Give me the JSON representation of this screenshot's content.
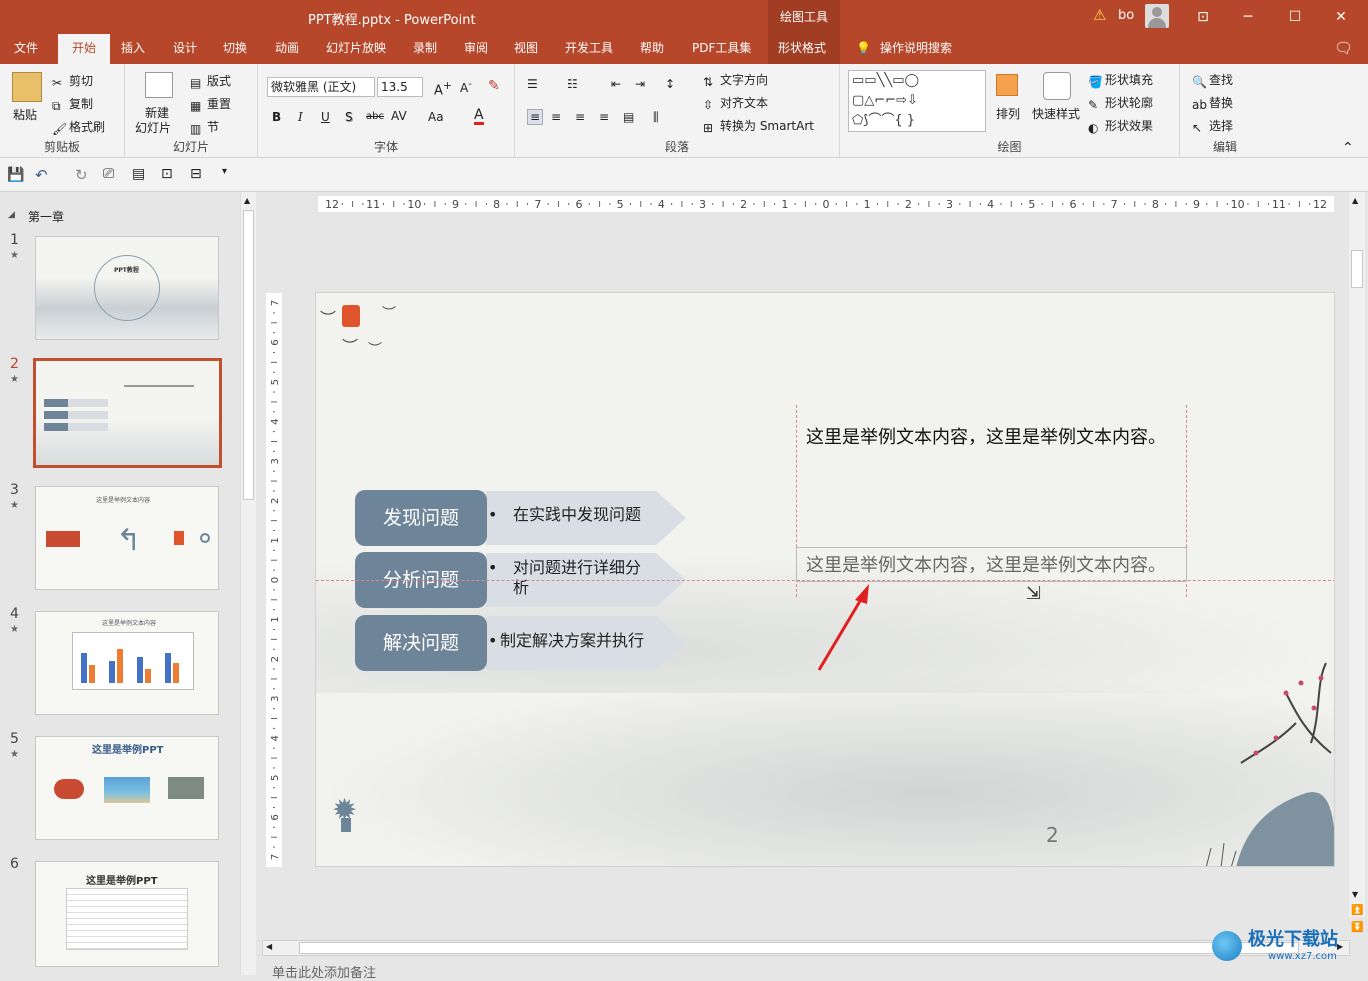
{
  "titlebar": {
    "title": "PPT教程.pptx  -  PowerPoint",
    "context_group": "绘图工具",
    "user": "bo",
    "minimize": "─",
    "restore": "❐",
    "maximize": "☐",
    "close": "✕",
    "display": "⊡"
  },
  "tabs": {
    "file": "文件",
    "home": "开始",
    "insert": "插入",
    "design": "设计",
    "transitions": "切换",
    "animations": "动画",
    "slideshow": "幻灯片放映",
    "record": "录制",
    "review": "审阅",
    "view": "视图",
    "developer": "开发工具",
    "help": "帮助",
    "pdf": "PDF工具集",
    "shape_format": "形状格式",
    "tell_me": "操作说明搜索"
  },
  "ribbon": {
    "clipboard": {
      "paste": "粘贴",
      "cut": "剪切",
      "copy": "复制",
      "format_painter": "格式刷",
      "label": "剪贴板"
    },
    "slides": {
      "new_slide": "新建",
      "new_slide_2": "幻灯片",
      "layout": "版式",
      "reset": "重置",
      "section": "节",
      "label": "幻灯片"
    },
    "font": {
      "font_name": "微软雅黑 (正文)",
      "font_size": "13.5",
      "label": "字体"
    },
    "paragraph": {
      "text_direction": "文字方向",
      "align_text": "对齐文本",
      "smartart": "转换为 SmartArt",
      "label": "段落"
    },
    "drawing": {
      "arrange": "排列",
      "quick_styles": "快速样式",
      "shape_fill": "形状填充",
      "shape_outline": "形状轮廓",
      "shape_effects": "形状效果",
      "label": "绘图"
    },
    "editing": {
      "find": "查找",
      "replace": "替换",
      "select": "选择",
      "label": "编辑"
    }
  },
  "slides_pane": {
    "section": "第一章",
    "slides": [
      {
        "num": "1",
        "title": "PPT教程"
      },
      {
        "num": "2",
        "title": ""
      },
      {
        "num": "3",
        "title": "这里是举例文本内容"
      },
      {
        "num": "4",
        "title": "这里是举例文本内容"
      },
      {
        "num": "5",
        "title": "这里是举例PPT"
      },
      {
        "num": "6",
        "title": "这里是举例PPT"
      }
    ]
  },
  "ruler": {
    "h_ticks": [
      "12",
      "11",
      "10",
      "9",
      "8",
      "7",
      "6",
      "5",
      "4",
      "3",
      "2",
      "1",
      "0",
      "1",
      "2",
      "3",
      "4",
      "5",
      "6",
      "7",
      "8",
      "9",
      "10",
      "11",
      "12"
    ],
    "v_ticks": [
      "7",
      "6",
      "5",
      "4",
      "3",
      "2",
      "1",
      "0",
      "1",
      "2",
      "3",
      "4",
      "5",
      "6",
      "7"
    ]
  },
  "slide": {
    "rows": [
      {
        "label": "发现问题",
        "bullet": "在实践中发现问题"
      },
      {
        "label": "分析问题",
        "bullet": "对问题进行详细分",
        "bullet_line2": "析"
      },
      {
        "label": "解决问题",
        "bullet": "制定解决方案并执行"
      }
    ],
    "bullet_char": "•",
    "textbox1": "这里是举例文本内容，这里是举例文本内容。",
    "textbox2": "这里是举例文本内容，这里是举例文本内容。",
    "page_number": "2"
  },
  "notes": {
    "placeholder": "单击此处添加备注"
  },
  "watermark": {
    "text": "极光下载站",
    "url": "www.xz7.com"
  }
}
